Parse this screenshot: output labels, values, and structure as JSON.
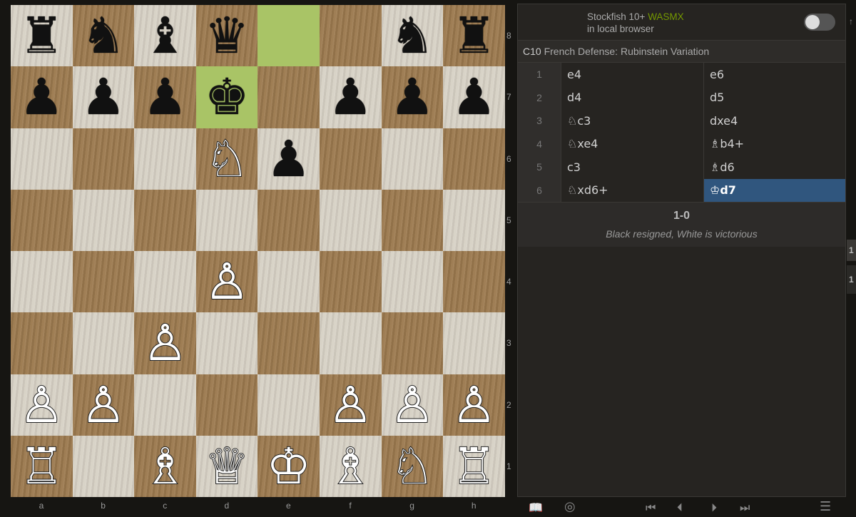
{
  "board": {
    "files": [
      "a",
      "b",
      "c",
      "d",
      "e",
      "f",
      "g",
      "h"
    ],
    "ranks": [
      "8",
      "7",
      "6",
      "5",
      "4",
      "3",
      "2",
      "1"
    ],
    "highlighted_squares": [
      "e8",
      "d7"
    ],
    "position": [
      [
        "♜",
        "♞",
        "♝",
        "♛",
        "",
        "",
        "♞",
        "♜"
      ],
      [
        "♟",
        "♟",
        "♟",
        "♚",
        "",
        "♟",
        "♟",
        "♟"
      ],
      [
        "",
        "",
        "",
        "♘",
        "♟",
        "",
        "",
        ""
      ],
      [
        "",
        "",
        "",
        "",
        "",
        "",
        "",
        ""
      ],
      [
        "",
        "",
        "",
        "♙",
        "",
        "",
        "",
        ""
      ],
      [
        "",
        "",
        "♙",
        "",
        "",
        "",
        "",
        ""
      ],
      [
        "♙",
        "♙",
        "",
        "",
        "",
        "♙",
        "♙",
        "♙"
      ],
      [
        "♖",
        "",
        "♗",
        "♕",
        "♔",
        "♗",
        "♘",
        "♖"
      ]
    ]
  },
  "engine": {
    "name": "Stockfish 10+",
    "tag": "WASMX",
    "location": "in local browser",
    "enabled": false
  },
  "opening": {
    "eco": "C10",
    "name": "French Defense: Rubinstein Variation"
  },
  "moves": [
    {
      "num": "1",
      "white": "e4",
      "black": "e6"
    },
    {
      "num": "2",
      "white": "d4",
      "black": "d5"
    },
    {
      "num": "3",
      "white": "♘c3",
      "black": "dxe4"
    },
    {
      "num": "4",
      "white": "♘xe4",
      "black": "♗b4+"
    },
    {
      "num": "5",
      "white": "c3",
      "black": "♗d6"
    },
    {
      "num": "6",
      "white": "♘xd6+",
      "black": "♔d7"
    }
  ],
  "active_move": {
    "row": 5,
    "side": "black"
  },
  "result": {
    "score": "1-0",
    "text": "Black resigned, White is victorious"
  },
  "toolbar": {
    "book_icon": "📖",
    "target_icon": "◎",
    "first_icon": "⏮",
    "prev_icon": "⏴",
    "next_icon": "⏵",
    "last_icon": "⏭",
    "menu_icon": "☰"
  },
  "sliver": {
    "tab1": "1",
    "tab2": "1",
    "top_glyph": "↑"
  }
}
